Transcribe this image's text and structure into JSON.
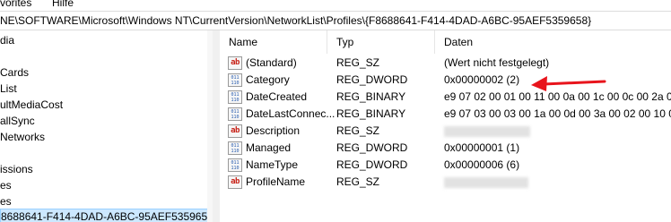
{
  "menu": {
    "favorites": "vorites",
    "help": "Hilfe"
  },
  "address": {
    "path": "NE\\SOFTWARE\\Microsoft\\Windows NT\\CurrentVersion\\NetworkList\\Profiles\\{F8688641-F414-4DAD-A6BC-95AEF5359658}"
  },
  "tree": {
    "items": [
      {
        "label": "dia"
      },
      {
        "label": ""
      },
      {
        "label": "Cards"
      },
      {
        "label": "List"
      },
      {
        "label": "ultMediaCost"
      },
      {
        "label": "allSync"
      },
      {
        "label": "Networks"
      },
      {
        "label": ""
      },
      {
        "label": "issions"
      },
      {
        "label": "es"
      },
      {
        "label": "es"
      },
      {
        "label": "8688641-F414-4DAD-A6BC-95AEF5359658}"
      }
    ]
  },
  "columns": {
    "name": "Name",
    "type": "Typ",
    "data": "Daten"
  },
  "values": [
    {
      "name": "(Standard)",
      "type": "REG_SZ",
      "data": "(Wert nicht festgelegt)",
      "icon": "string-value-icon"
    },
    {
      "name": "Category",
      "type": "REG_DWORD",
      "data": "0x00000002 (2)",
      "icon": "binary-value-icon"
    },
    {
      "name": "DateCreated",
      "type": "REG_BINARY",
      "data": "e9 07 02 00 01 00 11 00 0a 00 1c 00 0c 00 2a 03",
      "icon": "binary-value-icon"
    },
    {
      "name": "DateLastConnec...",
      "type": "REG_BINARY",
      "data": "e9 07 03 00 03 00 1a 00 0d 00 3a 00 02 00 10 01",
      "icon": "binary-value-icon"
    },
    {
      "name": "Description",
      "type": "REG_SZ",
      "data": "",
      "icon": "string-value-icon"
    },
    {
      "name": "Managed",
      "type": "REG_DWORD",
      "data": "0x00000001 (1)",
      "icon": "binary-value-icon"
    },
    {
      "name": "NameType",
      "type": "REG_DWORD",
      "data": "0x00000006 (6)",
      "icon": "binary-value-icon"
    },
    {
      "name": "ProfileName",
      "type": "REG_SZ",
      "data": "",
      "icon": "string-value-icon"
    }
  ],
  "icons": {
    "string_glyph": "ab",
    "binary_glyph": "011 110"
  },
  "colors": {
    "selection": "#cce8ff",
    "selection_border": "#99d1ff",
    "annotation_arrow": "#e8141c",
    "string_icon": "#c8241a",
    "binary_icon": "#2a5db0"
  }
}
